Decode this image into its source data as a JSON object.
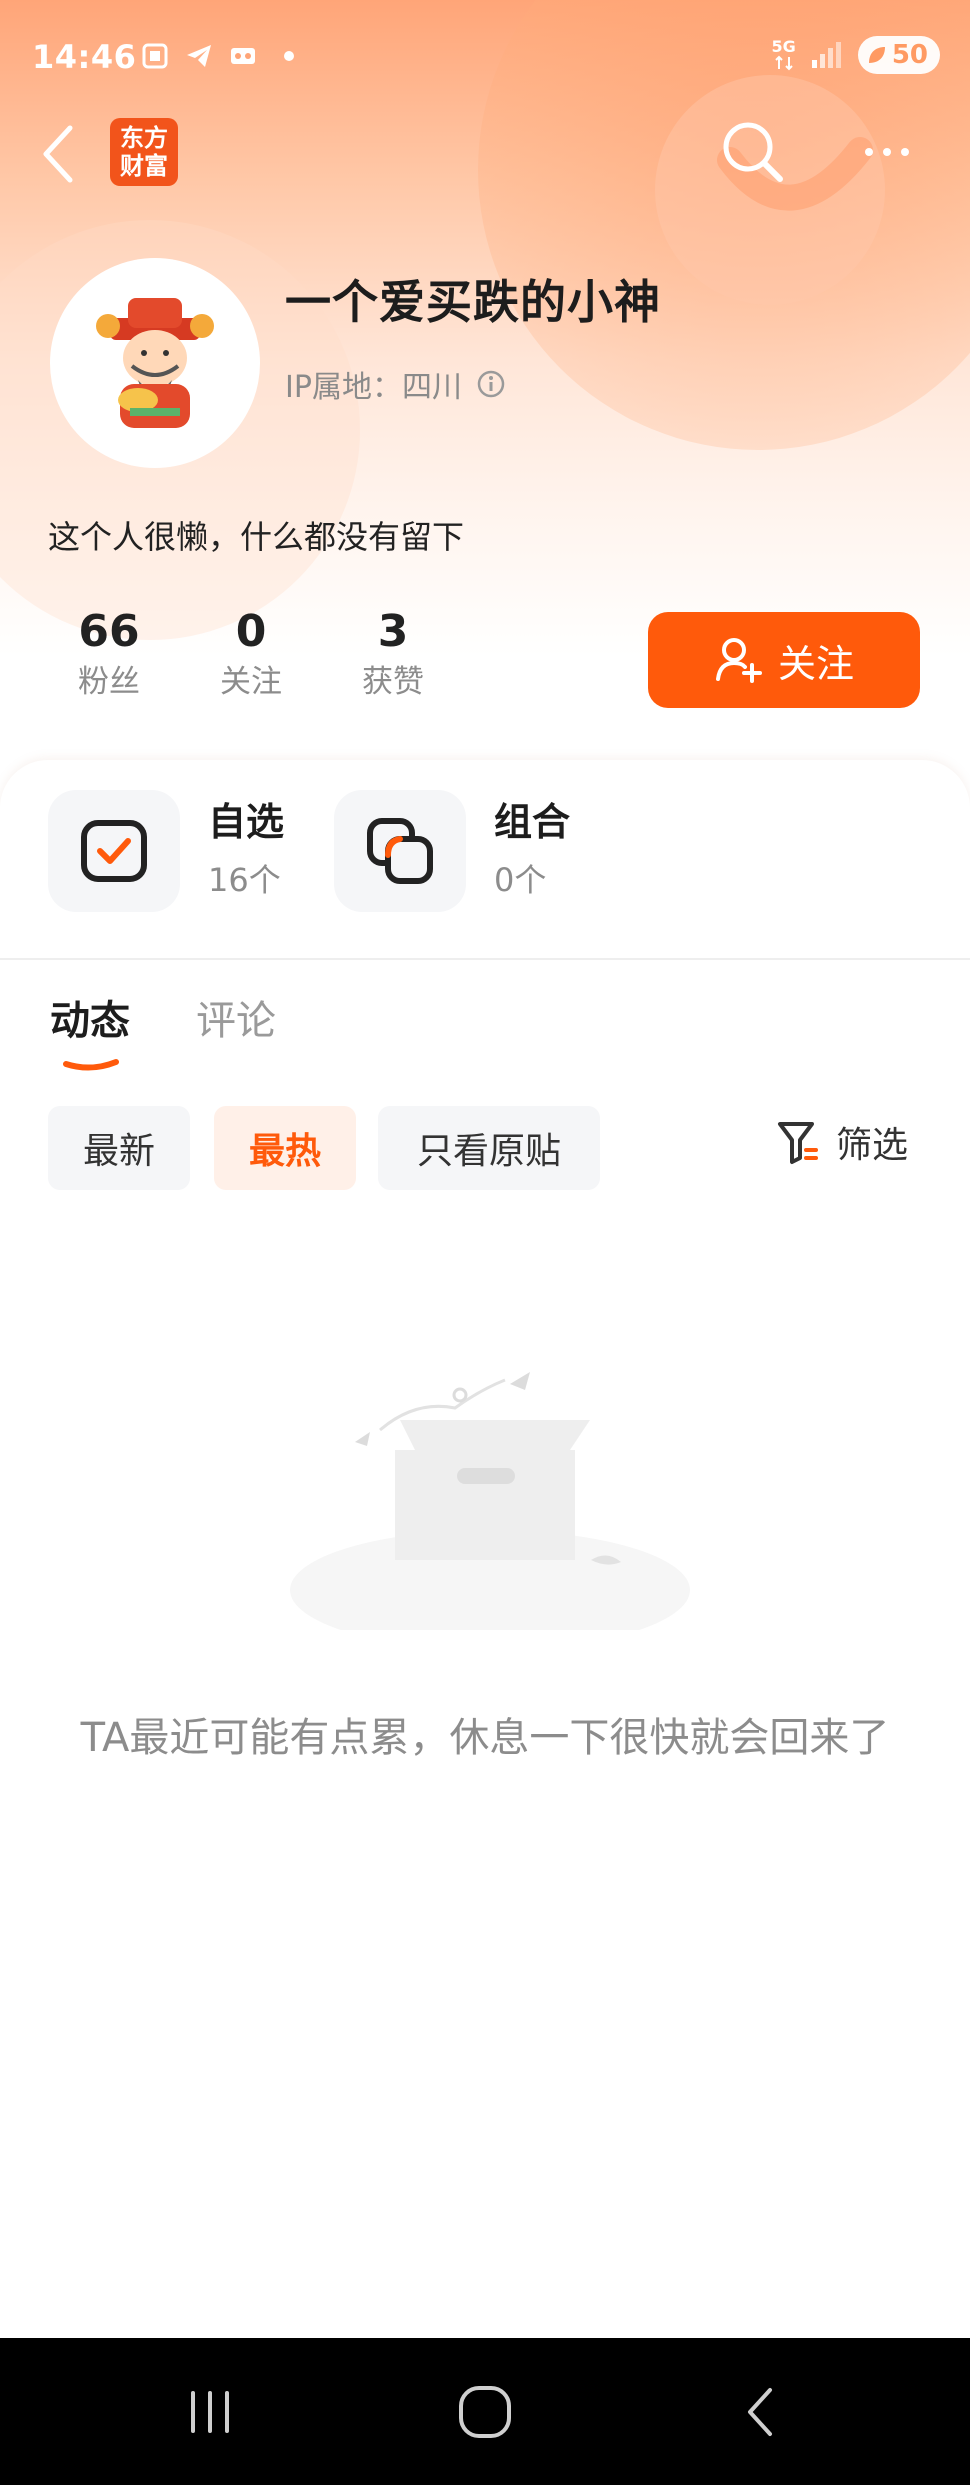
{
  "status_bar": {
    "time": "14:46",
    "network": "5G",
    "battery": "50"
  },
  "header": {
    "logo_line1": "东方",
    "logo_line2": "财富"
  },
  "profile": {
    "username": "一个爱买跌的小神",
    "ip_location": "IP属地：四川",
    "bio": "这个人很懒，什么都没有留下"
  },
  "stats": [
    {
      "value": "66",
      "label": "粉丝"
    },
    {
      "value": "0",
      "label": "关注"
    },
    {
      "value": "3",
      "label": "获赞"
    }
  ],
  "follow_button": "关注",
  "quick_entries": [
    {
      "title": "自选",
      "count": "16个"
    },
    {
      "title": "组合",
      "count": "0个"
    }
  ],
  "tabs": [
    "动态",
    "评论"
  ],
  "filters": [
    "最新",
    "最热",
    "只看原贴"
  ],
  "filter_action": "筛选",
  "empty_message": "TA最近可能有点累，休息一下很快就会回来了",
  "colors": {
    "accent": "#ff5a0b",
    "header_gradient_top": "#ffa578"
  }
}
